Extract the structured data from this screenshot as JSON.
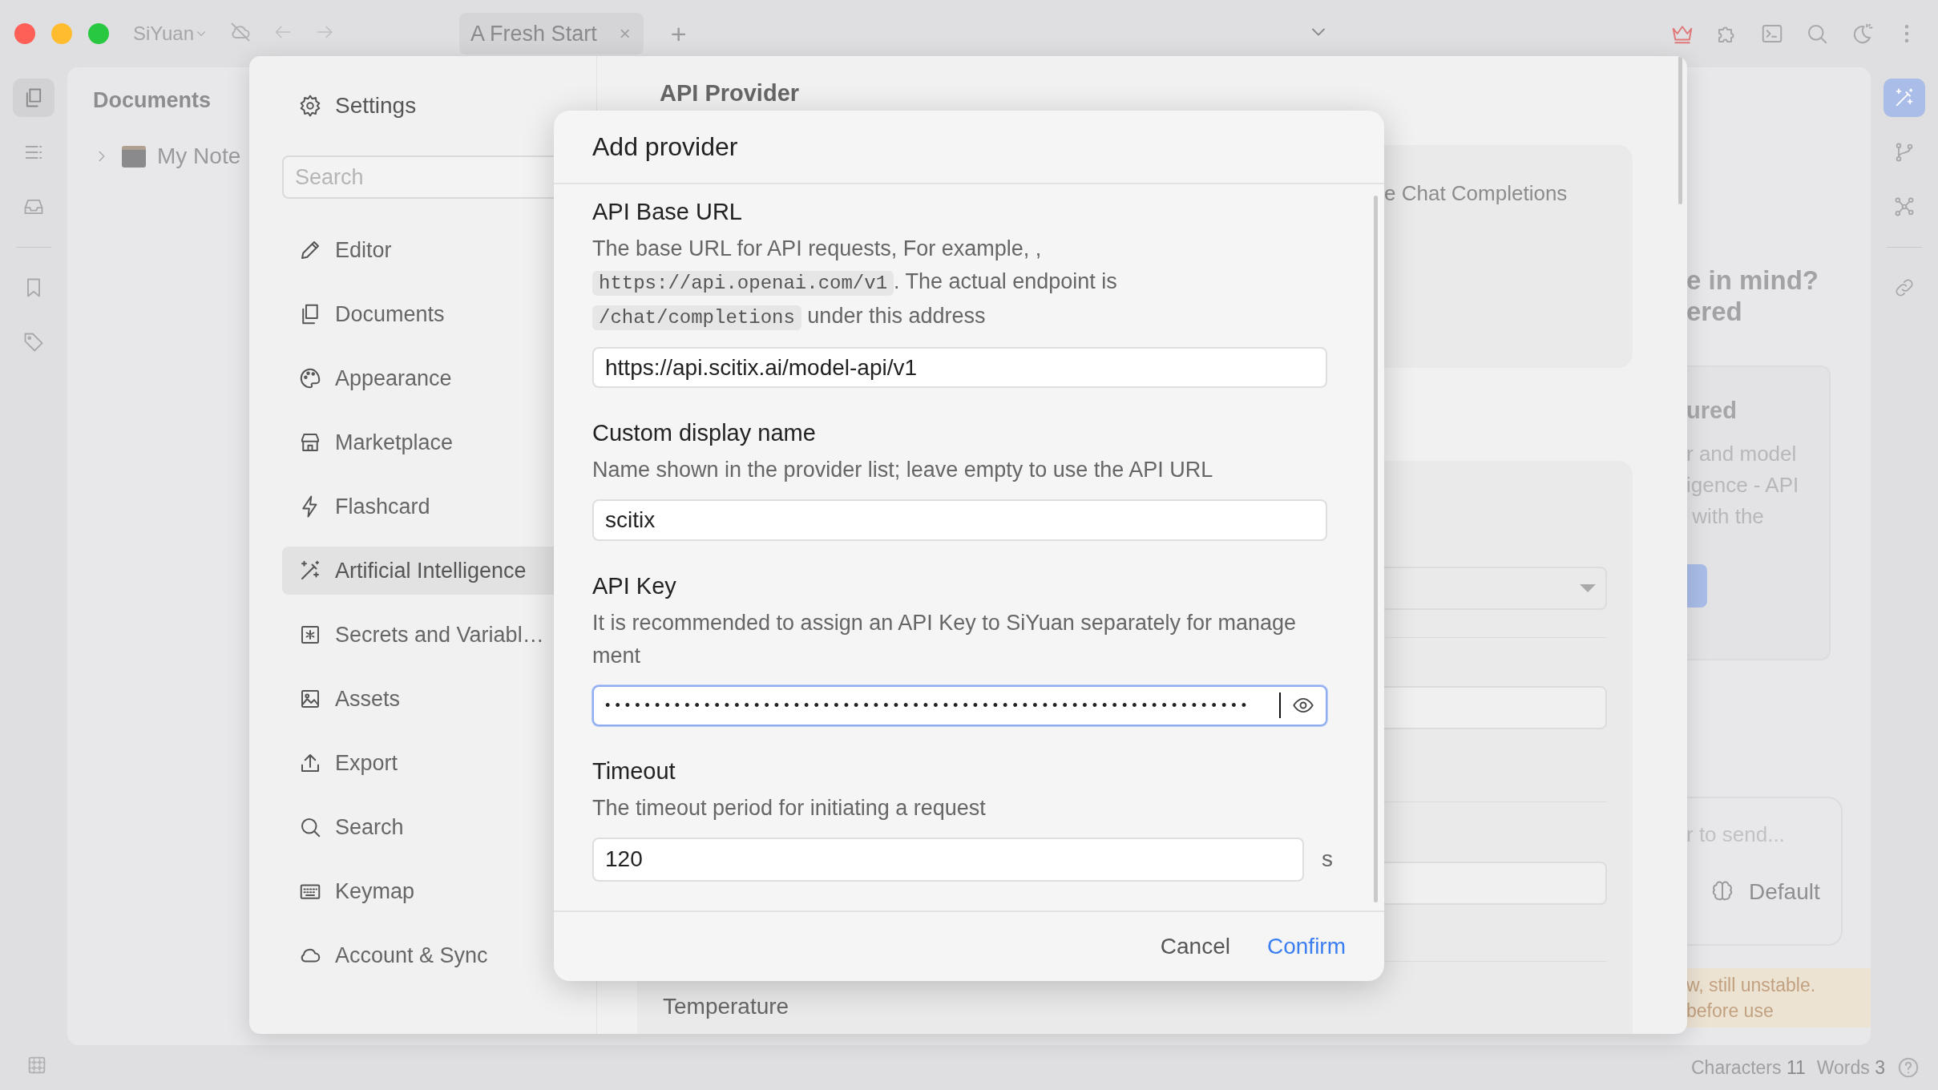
{
  "title_bar": {
    "app_name": "SiYuan",
    "tab": {
      "title": "A Fresh Start",
      "close": "×"
    },
    "new_tab": "+"
  },
  "left_rail": [
    {
      "kind": "documents",
      "selected": true
    },
    {
      "kind": "list",
      "selected": false
    },
    {
      "kind": "inbox",
      "selected": false
    },
    {
      "kind": "bookmark",
      "selected": false,
      "divider_before": true
    },
    {
      "kind": "tag",
      "selected": false
    }
  ],
  "documents_panel": {
    "title": "Documents",
    "notebooks": [
      {
        "name": "My Note",
        "expanded": false
      }
    ]
  },
  "chat_panel": {
    "heading_lines": [
      "e in mind?",
      "ered"
    ],
    "card": {
      "title": "ured",
      "lines": [
        "r and model",
        "igence - API",
        " with the"
      ]
    },
    "input": {
      "placeholder": "r to send...",
      "model": "Default"
    },
    "warning_lines": [
      "w, still unstable.",
      "before use"
    ]
  },
  "right_rail": [
    {
      "kind": "wand",
      "selected": true
    },
    {
      "kind": "branch",
      "selected": false
    },
    {
      "kind": "graph",
      "selected": false
    },
    {
      "kind": "link",
      "selected": false,
      "divider_before": true
    }
  ],
  "status_bar": {
    "characters_label": "Characters",
    "characters": "11",
    "words_label": "Words",
    "words": "3"
  },
  "settings": {
    "title": "Settings",
    "search": {
      "placeholder": "Search"
    },
    "nav": [
      {
        "kind": "editor",
        "label": "Editor",
        "selected": false
      },
      {
        "kind": "documents",
        "label": "Documents",
        "selected": false
      },
      {
        "kind": "appearance",
        "label": "Appearance",
        "selected": false
      },
      {
        "kind": "marketplace",
        "label": "Marketplace",
        "selected": false
      },
      {
        "kind": "flashcard",
        "label": "Flashcard",
        "selected": false
      },
      {
        "kind": "ai",
        "label": "Artificial Intelligence",
        "selected": true
      },
      {
        "kind": "secrets",
        "label": "Secrets and Variabl…",
        "selected": false
      },
      {
        "kind": "assets",
        "label": "Assets",
        "selected": false
      },
      {
        "kind": "export",
        "label": "Export",
        "selected": false
      },
      {
        "kind": "search",
        "label": "Search",
        "selected": false
      },
      {
        "kind": "keymap",
        "label": "Keymap",
        "selected": false
      },
      {
        "kind": "account",
        "label": "Account & Sync",
        "selected": false
      }
    ],
    "content": {
      "heading": "API Provider",
      "card_text": "e Chat Completions",
      "last_label": "Temperature"
    }
  },
  "dialog": {
    "title": "Add provider",
    "fields": [
      {
        "kind": "text",
        "label": "API Base URL",
        "description": [
          {
            "kind": "text",
            "text": "The base URL for API requests, For example, , "
          },
          {
            "kind": "code",
            "text": "https://api.openai.com/v1"
          },
          {
            "kind": "text",
            "text": ". The actual endpoint is "
          },
          {
            "kind": "code",
            "text": "/chat/completions"
          },
          {
            "kind": "text",
            "text": " under this address"
          }
        ],
        "value": "https://api.scitix.ai/model-api/v1",
        "focused": false
      },
      {
        "kind": "text",
        "label": "Custom display name",
        "description": [
          {
            "kind": "text",
            "text": "Name shown in the provider list; leave empty to use the API URL"
          }
        ],
        "value": "scitix",
        "focused": false
      },
      {
        "kind": "password",
        "label": "API Key",
        "description": [
          {
            "kind": "text",
            "text": "It is recommended to assign an API Key to SiYuan separately for management"
          }
        ],
        "value": "•••••••••••••••••••••••••••••••••••••••••••••••••••••••••••••••••",
        "focused": true
      },
      {
        "kind": "number",
        "label": "Timeout",
        "description": [
          {
            "kind": "text",
            "text": "The timeout period for initiating a request"
          }
        ],
        "value": "120",
        "unit": "s",
        "focused": false
      }
    ],
    "buttons": [
      {
        "label": "Cancel",
        "primary": false
      },
      {
        "label": "Confirm",
        "primary": true
      }
    ]
  }
}
